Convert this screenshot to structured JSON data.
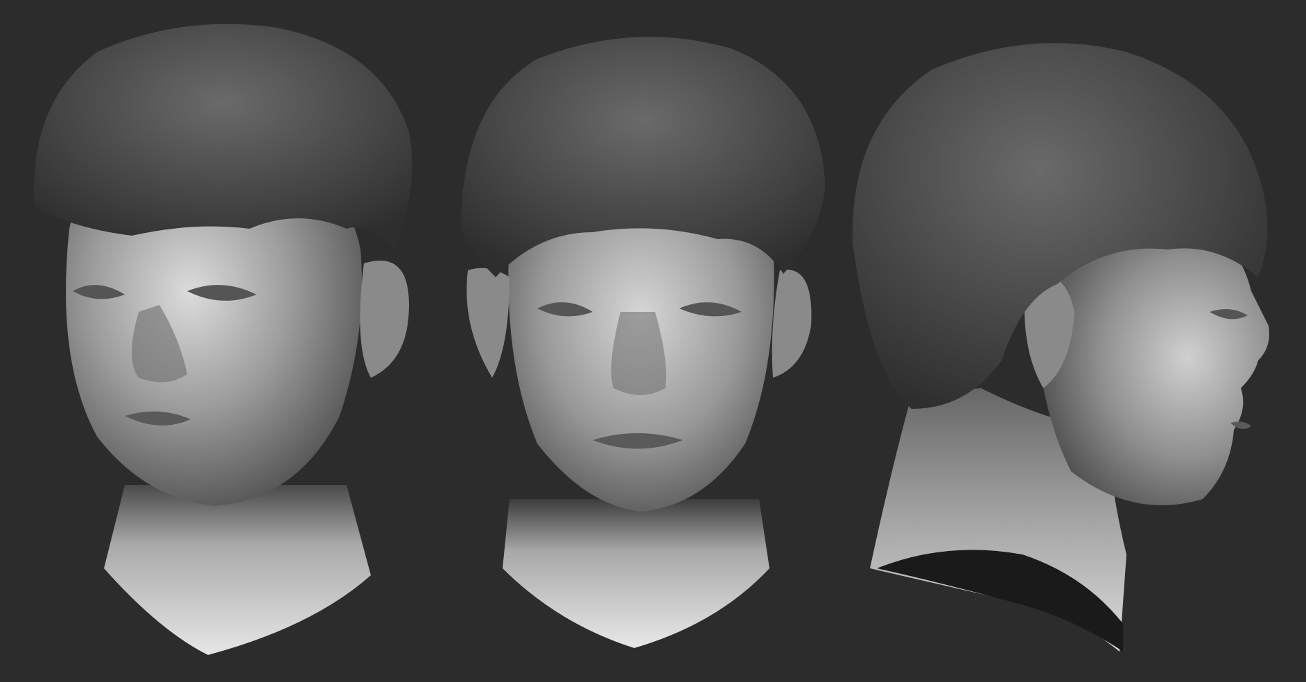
{
  "scene": {
    "background_color": "#2c2c2c",
    "clay_light": "#e2e2e2",
    "clay_mid": "#8e8e8e",
    "clay_dark": "#3a3a3a",
    "hair_color": "#4a4a4a"
  },
  "views": [
    {
      "name": "three-quarter-left-view"
    },
    {
      "name": "front-view"
    },
    {
      "name": "right-profile-view"
    }
  ]
}
